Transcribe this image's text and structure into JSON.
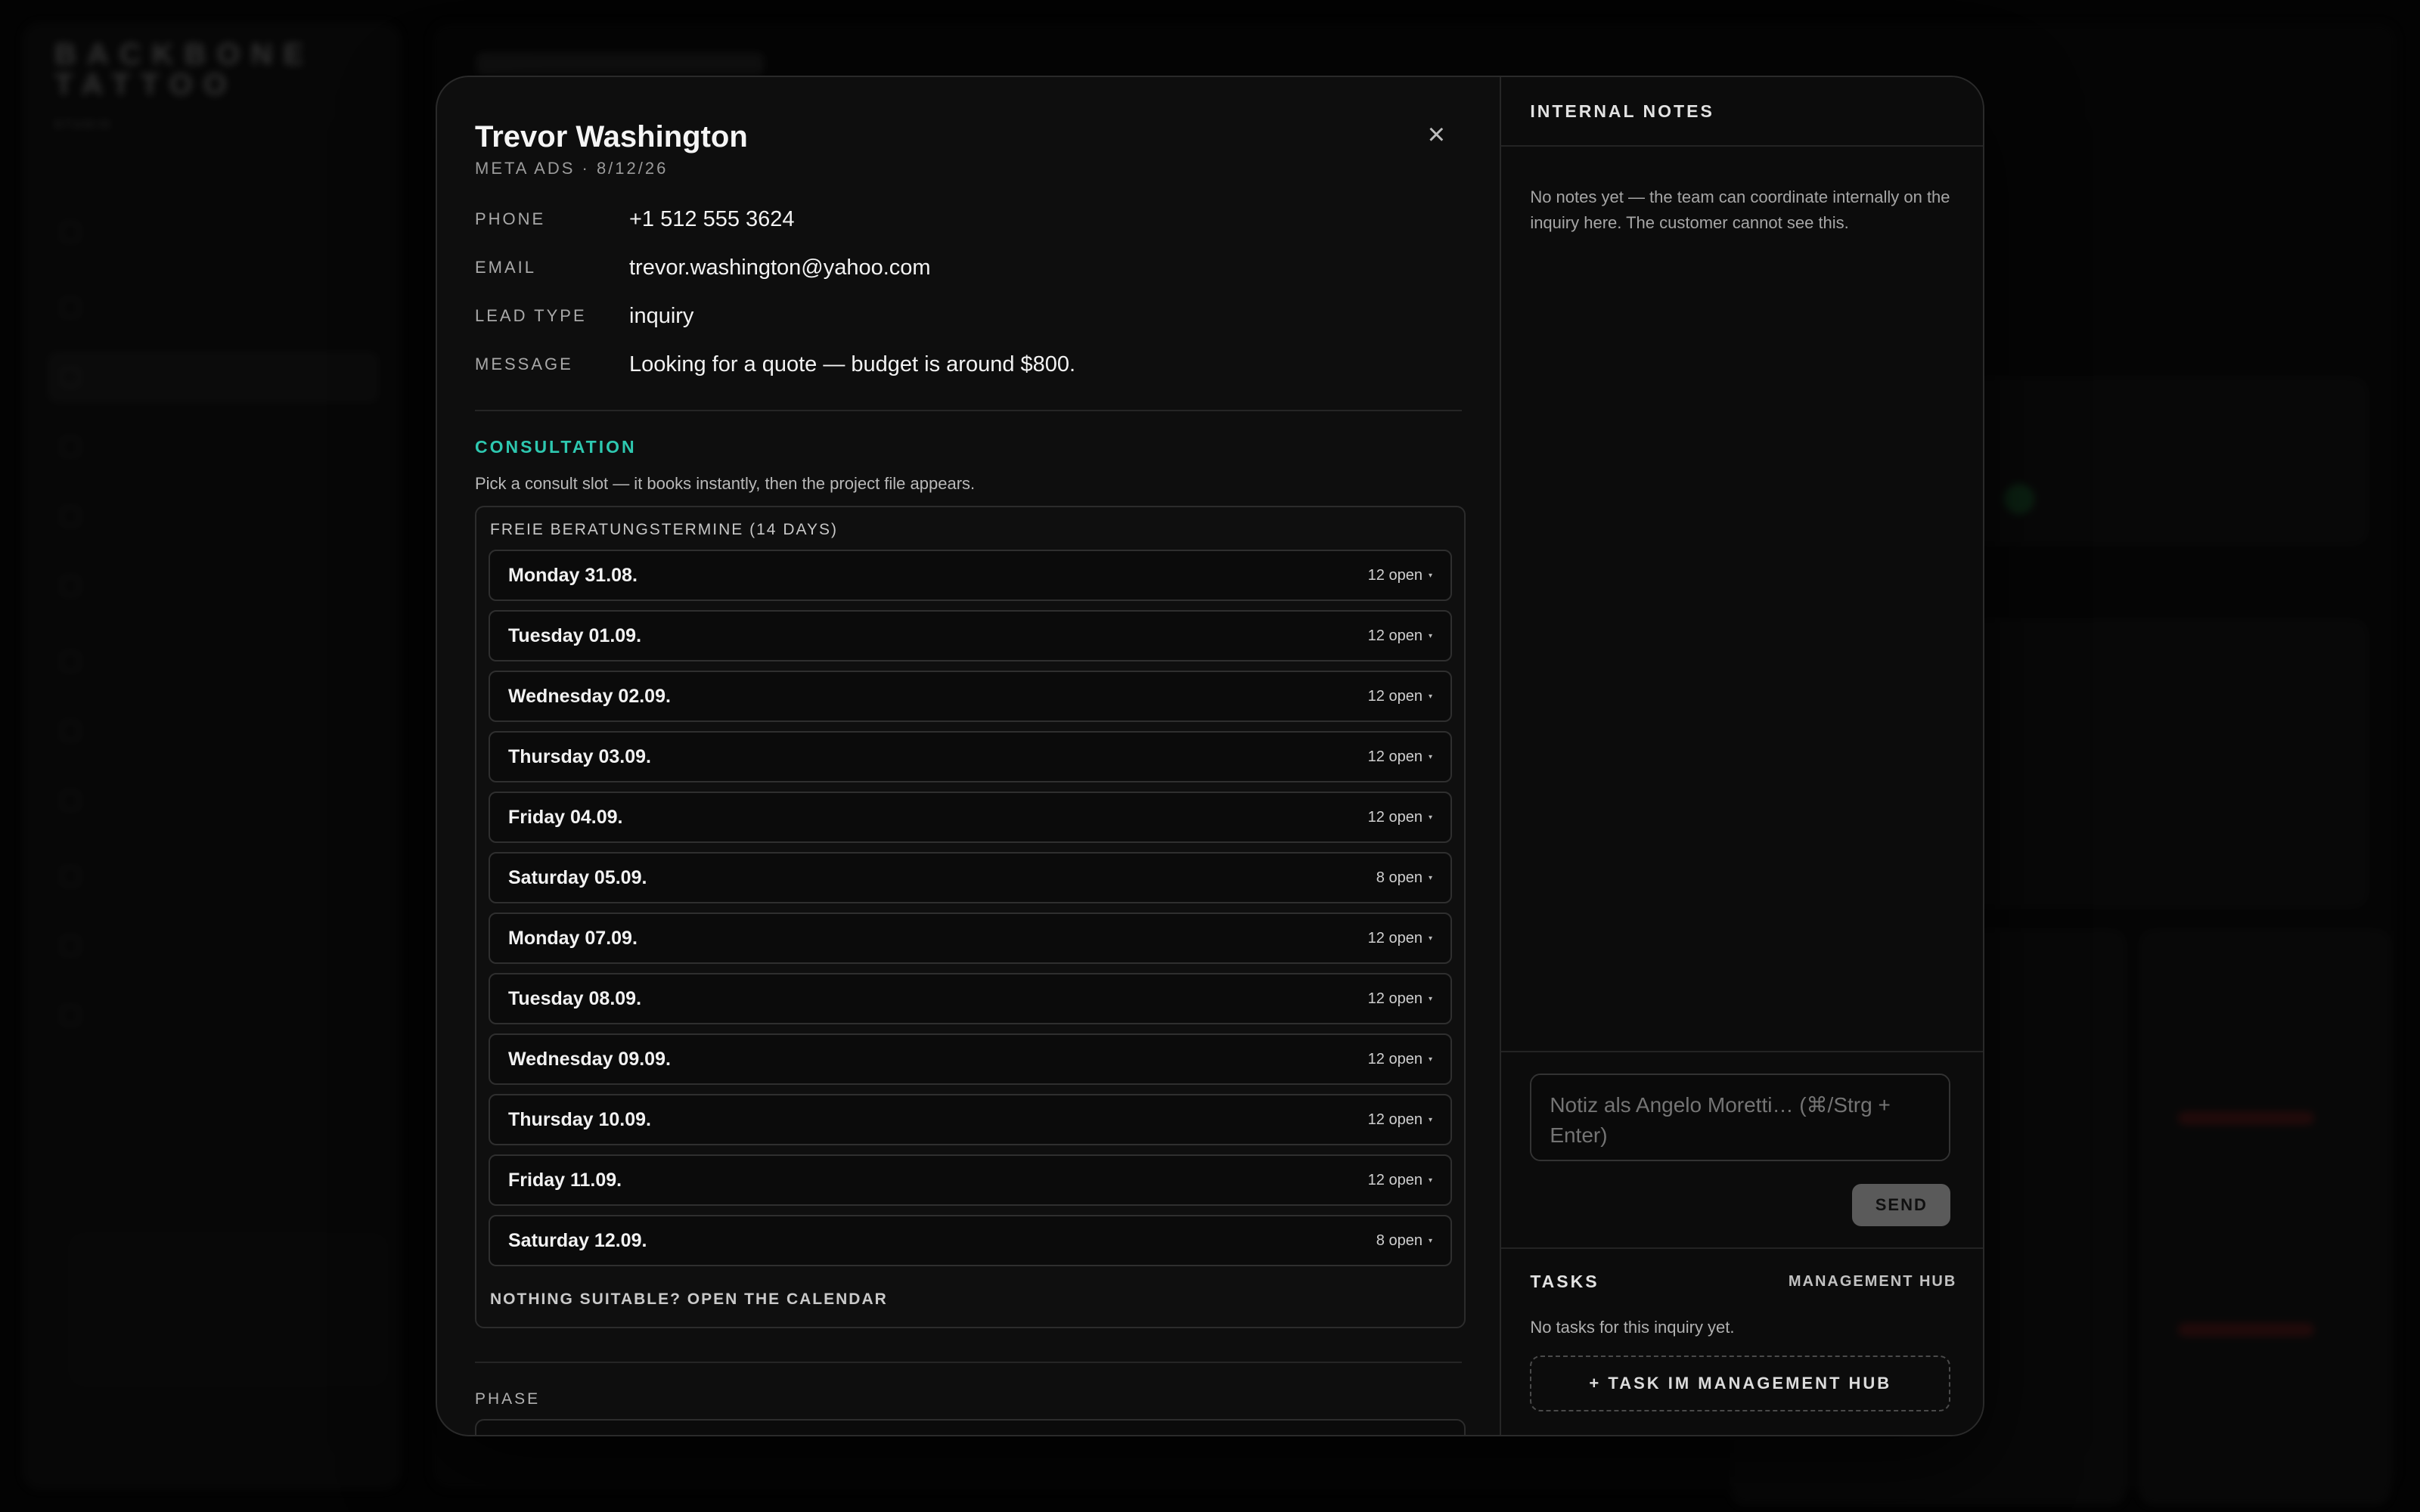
{
  "lead": {
    "name": "Trevor Washington",
    "source_line": "META ADS · 8/12/26",
    "close_glyph": "×",
    "fields": [
      {
        "label": "PHONE",
        "value": "+1 512 555 3624"
      },
      {
        "label": "EMAIL",
        "value": "trevor.washington@yahoo.com"
      },
      {
        "label": "LEAD TYPE",
        "value": "inquiry"
      },
      {
        "label": "MESSAGE",
        "value": "Looking for a quote — budget is around $800."
      }
    ]
  },
  "consultation": {
    "title": "CONSULTATION",
    "hint": "Pick a consult slot — it books instantly, then the project file appears.",
    "box_title": "FREIE BERATUNGSTERMINE (14 DAYS)",
    "slots": [
      {
        "day": "Monday 31.08.",
        "count": "12 open"
      },
      {
        "day": "Tuesday 01.09.",
        "count": "12 open"
      },
      {
        "day": "Wednesday 02.09.",
        "count": "12 open"
      },
      {
        "day": "Thursday 03.09.",
        "count": "12 open"
      },
      {
        "day": "Friday 04.09.",
        "count": "12 open"
      },
      {
        "day": "Saturday 05.09.",
        "count": "8 open"
      },
      {
        "day": "Monday 07.09.",
        "count": "12 open"
      },
      {
        "day": "Tuesday 08.09.",
        "count": "12 open"
      },
      {
        "day": "Wednesday 09.09.",
        "count": "12 open"
      },
      {
        "day": "Thursday 10.09.",
        "count": "12 open"
      },
      {
        "day": "Friday 11.09.",
        "count": "12 open"
      },
      {
        "day": "Saturday 12.09.",
        "count": "8 open"
      }
    ],
    "chevron_glyph": "▾",
    "calendar_link": "NOTHING SUITABLE? OPEN THE CALENDAR"
  },
  "phase": {
    "label": "PHASE"
  },
  "notes": {
    "title": "INTERNAL NOTES",
    "empty_text": "No notes yet — the team can coordinate internally on the inquiry here. The customer cannot see this.",
    "input_placeholder": "Notiz als Angelo Moretti… (⌘/Strg + Enter)",
    "send_label": "SEND"
  },
  "tasks": {
    "title": "TASKS",
    "hub_link": "MANAGEMENT HUB",
    "empty_text": "No tasks for this inquiry yet.",
    "add_label": "+ TASK IM MANAGEMENT HUB"
  },
  "colors": {
    "accent": "#2ec8b0",
    "modal_bg": "#0e0e0e",
    "send_bg": "#5a5a5a"
  }
}
